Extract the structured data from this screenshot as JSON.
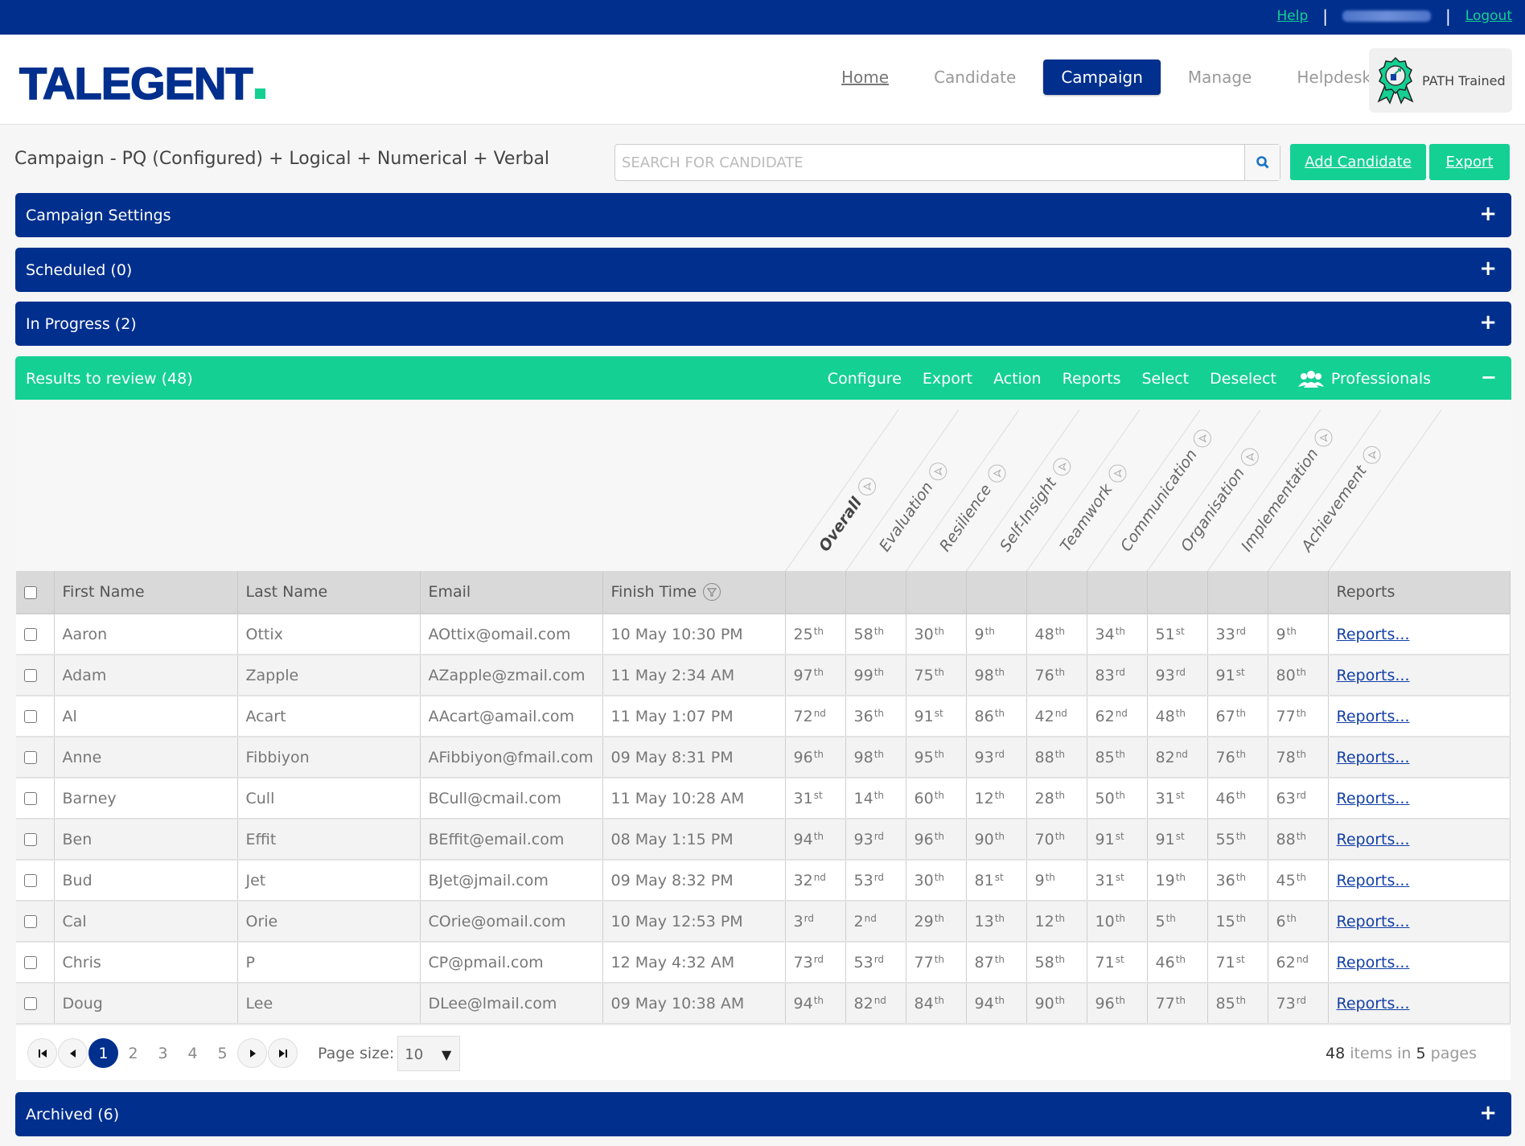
{
  "topbar": {
    "help": "Help",
    "separator": "|",
    "logout": "Logout"
  },
  "header": {
    "logo": "TALEGENT",
    "nav": [
      {
        "label": "Home",
        "state": "link"
      },
      {
        "label": "Candidate",
        "state": "normal"
      },
      {
        "label": "Campaign",
        "state": "active"
      },
      {
        "label": "Manage",
        "state": "normal"
      },
      {
        "label": "Helpdesk",
        "state": "normal"
      }
    ],
    "badge_label": "PATH Trained"
  },
  "title": "Campaign - PQ (Configured) + Logical + Numerical + Verbal",
  "search": {
    "placeholder": "SEARCH FOR CANDIDATE",
    "value": ""
  },
  "buttons": {
    "add_candidate": "Add Candidate",
    "export": "Export"
  },
  "panels": {
    "campaign_settings": "Campaign Settings",
    "scheduled": "Scheduled (0)",
    "in_progress": "In Progress (2)",
    "results": "Results to review (48)",
    "archived": "Archived (6)",
    "expand_symbol": "+",
    "collapse_symbol": "−"
  },
  "results_actions": [
    "Configure",
    "Export",
    "Action",
    "Reports",
    "Select",
    "Deselect"
  ],
  "professionals_label": "Professionals",
  "score_columns": [
    "Overall",
    "Evaluation",
    "Resilience",
    "Self-Insight",
    "Teamwork",
    "Communication",
    "Organisation",
    "Implementation",
    "Achievement"
  ],
  "table": {
    "headers": {
      "first": "First Name",
      "last": "Last Name",
      "email": "Email",
      "finish": "Finish Time",
      "reports": "Reports"
    },
    "rows": [
      {
        "first": "Aaron",
        "last": "Ottix",
        "email": "AOttix@omail.com",
        "finish": "10 May 10:30 PM",
        "scores": [
          [
            25,
            "th"
          ],
          [
            58,
            "th"
          ],
          [
            30,
            "th"
          ],
          [
            9,
            "th"
          ],
          [
            48,
            "th"
          ],
          [
            34,
            "th"
          ],
          [
            51,
            "st"
          ],
          [
            33,
            "rd"
          ],
          [
            9,
            "th"
          ]
        ],
        "report": "Reports..."
      },
      {
        "first": "Adam",
        "last": "Zapple",
        "email": "AZapple@zmail.com",
        "finish": "11 May 2:34 AM",
        "scores": [
          [
            97,
            "th"
          ],
          [
            99,
            "th"
          ],
          [
            75,
            "th"
          ],
          [
            98,
            "th"
          ],
          [
            76,
            "th"
          ],
          [
            83,
            "rd"
          ],
          [
            93,
            "rd"
          ],
          [
            91,
            "st"
          ],
          [
            80,
            "th"
          ]
        ],
        "report": "Reports..."
      },
      {
        "first": "Al",
        "last": "Acart",
        "email": "AAcart@amail.com",
        "finish": "11 May 1:07 PM",
        "scores": [
          [
            72,
            "nd"
          ],
          [
            36,
            "th"
          ],
          [
            91,
            "st"
          ],
          [
            86,
            "th"
          ],
          [
            42,
            "nd"
          ],
          [
            62,
            "nd"
          ],
          [
            48,
            "th"
          ],
          [
            67,
            "th"
          ],
          [
            77,
            "th"
          ]
        ],
        "report": "Reports..."
      },
      {
        "first": "Anne",
        "last": "Fibbiyon",
        "email": "AFibbiyon@fmail.com",
        "finish": "09 May 8:31 PM",
        "scores": [
          [
            96,
            "th"
          ],
          [
            98,
            "th"
          ],
          [
            95,
            "th"
          ],
          [
            93,
            "rd"
          ],
          [
            88,
            "th"
          ],
          [
            85,
            "th"
          ],
          [
            82,
            "nd"
          ],
          [
            76,
            "th"
          ],
          [
            78,
            "th"
          ]
        ],
        "report": "Reports..."
      },
      {
        "first": "Barney",
        "last": "Cull",
        "email": "BCull@cmail.com",
        "finish": "11 May 10:28 AM",
        "scores": [
          [
            31,
            "st"
          ],
          [
            14,
            "th"
          ],
          [
            60,
            "th"
          ],
          [
            12,
            "th"
          ],
          [
            28,
            "th"
          ],
          [
            50,
            "th"
          ],
          [
            31,
            "st"
          ],
          [
            46,
            "th"
          ],
          [
            63,
            "rd"
          ]
        ],
        "report": "Reports..."
      },
      {
        "first": "Ben",
        "last": "Effit",
        "email": "BEffit@email.com",
        "finish": "08 May 1:15 PM",
        "scores": [
          [
            94,
            "th"
          ],
          [
            93,
            "rd"
          ],
          [
            96,
            "th"
          ],
          [
            90,
            "th"
          ],
          [
            70,
            "th"
          ],
          [
            91,
            "st"
          ],
          [
            91,
            "st"
          ],
          [
            55,
            "th"
          ],
          [
            88,
            "th"
          ]
        ],
        "report": "Reports..."
      },
      {
        "first": "Bud",
        "last": "Jet",
        "email": "BJet@jmail.com",
        "finish": "09 May 8:32 PM",
        "scores": [
          [
            32,
            "nd"
          ],
          [
            53,
            "rd"
          ],
          [
            30,
            "th"
          ],
          [
            81,
            "st"
          ],
          [
            9,
            "th"
          ],
          [
            31,
            "st"
          ],
          [
            19,
            "th"
          ],
          [
            36,
            "th"
          ],
          [
            45,
            "th"
          ]
        ],
        "report": "Reports..."
      },
      {
        "first": "Cal",
        "last": "Orie",
        "email": "COrie@omail.com",
        "finish": "10 May 12:53 PM",
        "scores": [
          [
            3,
            "rd"
          ],
          [
            2,
            "nd"
          ],
          [
            29,
            "th"
          ],
          [
            13,
            "th"
          ],
          [
            12,
            "th"
          ],
          [
            10,
            "th"
          ],
          [
            5,
            "th"
          ],
          [
            15,
            "th"
          ],
          [
            6,
            "th"
          ]
        ],
        "report": "Reports..."
      },
      {
        "first": "Chris",
        "last": "P",
        "email": "CP@pmail.com",
        "finish": "12 May 4:32 AM",
        "scores": [
          [
            73,
            "rd"
          ],
          [
            53,
            "rd"
          ],
          [
            77,
            "th"
          ],
          [
            87,
            "th"
          ],
          [
            58,
            "th"
          ],
          [
            71,
            "st"
          ],
          [
            46,
            "th"
          ],
          [
            71,
            "st"
          ],
          [
            62,
            "nd"
          ]
        ],
        "report": "Reports..."
      },
      {
        "first": "Doug",
        "last": "Lee",
        "email": "DLee@lmail.com",
        "finish": "09 May 10:38 AM",
        "scores": [
          [
            94,
            "th"
          ],
          [
            82,
            "nd"
          ],
          [
            84,
            "th"
          ],
          [
            94,
            "th"
          ],
          [
            90,
            "th"
          ],
          [
            96,
            "th"
          ],
          [
            77,
            "th"
          ],
          [
            85,
            "th"
          ],
          [
            73,
            "rd"
          ]
        ],
        "report": "Reports..."
      }
    ]
  },
  "pagination": {
    "pages": [
      "1",
      "2",
      "3",
      "4",
      "5"
    ],
    "current": "1",
    "page_size_label": "Page size:",
    "page_size": "10",
    "total_items": "48",
    "items_in_text": "items in",
    "total_pages": "5",
    "pages_text": "pages"
  },
  "colors": {
    "brand_blue": "#002f8e",
    "brand_green": "#14d093",
    "link_blue": "#123fa6"
  }
}
